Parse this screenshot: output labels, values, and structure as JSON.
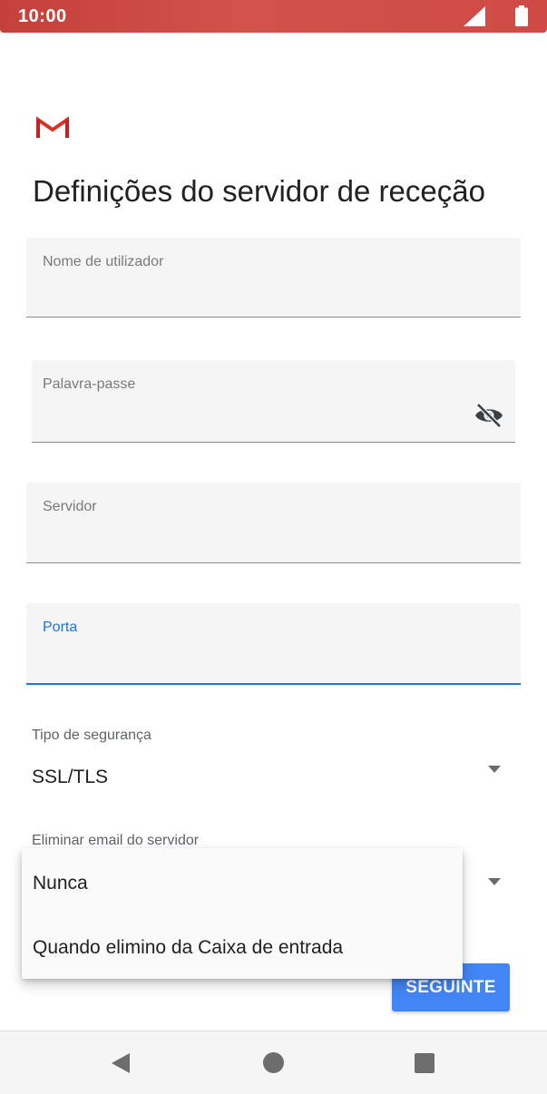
{
  "status_bar": {
    "time": "10:00",
    "icons": [
      "signal-icon",
      "battery-icon"
    ]
  },
  "app": {
    "logo": "gmail-logo",
    "colors": {
      "accent": "#1a73e8",
      "button": "#4285f4",
      "status_bar": "#cf4a45"
    }
  },
  "header": {
    "title": "Definições do servidor de receção"
  },
  "form": {
    "username": {
      "label": "Nome de utilizador",
      "value": ""
    },
    "password": {
      "label": "Palavra-passe",
      "value": "",
      "toggle_icon": "eye-off-icon"
    },
    "server": {
      "label": "Servidor",
      "value": ""
    },
    "port": {
      "label": "Porta",
      "value": "",
      "focused": true
    },
    "security_type": {
      "label": "Tipo de segurança",
      "value": "SSL/TLS"
    },
    "delete_email": {
      "label": "Eliminar email do servidor"
    }
  },
  "menu": {
    "items": [
      "Nunca",
      "Quando elimino da Caixa de entrada"
    ]
  },
  "actions": {
    "next_label": "SEGUINTE"
  },
  "nav_bar": {
    "icons": [
      "back-icon",
      "home-icon",
      "recents-icon"
    ]
  }
}
